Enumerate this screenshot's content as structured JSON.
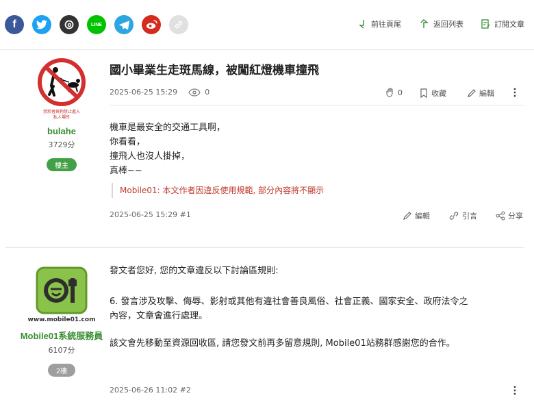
{
  "share": {
    "facebook": "f",
    "line": "LINE"
  },
  "topnav": {
    "last_page": "前往頁尾",
    "back_list": "返回列表",
    "subscribe": "訂閱文章"
  },
  "post1": {
    "author": {
      "name": "bulahe",
      "score": "3729分",
      "badge": "樓主",
      "avatar_lettering": "禁菸者與狗禁止進入 私人場所"
    },
    "title": "國小畢業生走斑馬線，被闖紅燈機車撞飛",
    "datetime": "2025-06-25 15:29",
    "views": "0",
    "likes": "0",
    "bookmark": "收藏",
    "edit": "編輯",
    "lines": [
      "機車是最安全的交通工具啊，",
      "你看看，",
      "撞飛人也沒人掛掉，",
      "真棒~~"
    ],
    "notice": "Mobile01: 本文作者因違反使用規範, 部分內容將不顯示",
    "footer_meta": "2025-06-25 15:29 #1",
    "footer_edit": "編輯",
    "footer_quote": "引言",
    "footer_share": "分享"
  },
  "post2": {
    "author": {
      "name": "Mobile01系統服務員",
      "score": "6107分",
      "badge": "2樓",
      "avatar_lettering": "www.mobile01.com"
    },
    "p1": "發文者您好, 您的文章違反以下討論區規則:",
    "rule_num": "6.",
    "rule_line1": "發言涉及攻擊、侮辱、影射或其他有違社會善良風俗、社會正義、國家安全、政府法令之",
    "rule_line2": "內容，文章會進行處理。",
    "p3": "該文會先移動至資源回收區, 請您發文前再多留意規則, Mobile01站務群感謝您的合作。",
    "footer_meta": "2025-06-26 11:02 #2"
  },
  "colors": {
    "accent_green": "#3a8c33",
    "badge_green": "#43a047",
    "badge_grey": "#9e9e9e",
    "notice_red": "#c0392b"
  }
}
